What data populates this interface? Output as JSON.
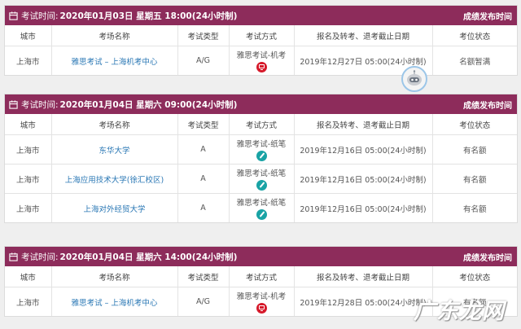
{
  "columns": [
    "城市",
    "考场名称",
    "考试类型",
    "考试方式",
    "报名及转考、退考截止日期",
    "考位状态"
  ],
  "sessions": [
    {
      "time_label": "考试时间:",
      "time_value": "2020年01月03日 星期五 18:00(24小时制)",
      "result_link": "成绩发布时间",
      "rows": [
        {
          "city": "上海市",
          "venue": "雅思考试 – 上海机考中心",
          "type": "A/G",
          "mode": "雅思考试-机考",
          "mode_icon": "computer-icon",
          "deadline": "2019年12月27日 05:00(24小时制)",
          "status": "名额暂满"
        }
      ]
    },
    {
      "time_label": "考试时间:",
      "time_value": "2020年01月04日 星期六 09:00(24小时制)",
      "result_link": "成绩发布时间",
      "rows": [
        {
          "city": "上海市",
          "venue": "东华大学",
          "type": "A",
          "mode": "雅思考试-纸笔",
          "mode_icon": "pen-icon",
          "deadline": "2019年12月16日 05:00(24小时制)",
          "status": "有名额"
        },
        {
          "city": "上海市",
          "venue": "上海应用技术大学(徐汇校区)",
          "type": "A",
          "mode": "雅思考试-纸笔",
          "mode_icon": "pen-icon",
          "deadline": "2019年12月16日 05:00(24小时制)",
          "status": "有名额"
        },
        {
          "city": "上海市",
          "venue": "上海对外经贸大学",
          "type": "A",
          "mode": "雅思考试-纸笔",
          "mode_icon": "pen-icon",
          "deadline": "2019年12月16日 05:00(24小时制)",
          "status": "有名额"
        }
      ]
    },
    {
      "time_label": "考试时间:",
      "time_value": "2020年01月04日 星期六 14:00(24小时制)",
      "result_link": "成绩发布时间",
      "rows": [
        {
          "city": "上海市",
          "venue": "雅思考试 – 上海机考中心",
          "type": "A/G",
          "mode": "雅思考试-机考",
          "mode_icon": "computer-icon",
          "deadline": "2019年12月28日 05:00(24小时制)",
          "status": "有名额"
        }
      ]
    }
  ],
  "watermark": "广东龙网",
  "colors": {
    "header": "#8d2c5b",
    "link": "#2b78b5",
    "computer_icon": "#d6192a",
    "pen_icon": "#19a3a5"
  }
}
